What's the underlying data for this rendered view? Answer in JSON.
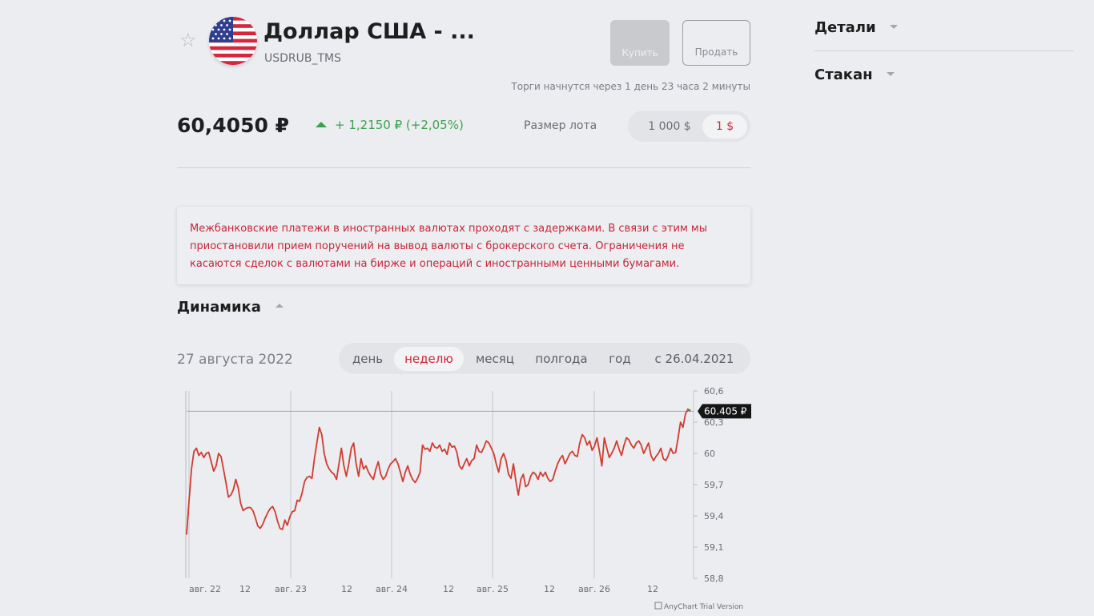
{
  "header": {
    "title": "Доллар США - ...",
    "ticker": "USDRUB_TMS",
    "buy_label": "Купить",
    "sell_label": "Продать",
    "trading_note": "Торги начнутся через 1 день 23 часа 2 минуты"
  },
  "price": {
    "value": "60,4050 ₽",
    "change": "+ 1,2150 ₽ (+2,05%)"
  },
  "lot": {
    "label": "Размер лота",
    "options": [
      "1 000 $",
      "1 $"
    ],
    "selected": "1 $"
  },
  "notice": {
    "text": "Межбанковские платежи в иностранных валютах проходят с задержками. В связи с этим мы приостановили прием поручений на вывод валюты с брокерского счета. Ограничения не касаются сделок с валютами на бирже и операций с иностранными ценными бумагами."
  },
  "dynamics": {
    "title": "Динамика",
    "date": "27 августа 2022",
    "periods": [
      "день",
      "неделю",
      "месяц",
      "полгода",
      "год",
      "с 26.04.2021"
    ],
    "active_period": "неделю"
  },
  "sidebar": {
    "details": "Детали",
    "orderbook": "Стакан"
  },
  "chart_data": {
    "type": "line",
    "x_ticks": [
      "авг. 22",
      "12",
      "авг. 23",
      "12",
      "авг. 24",
      "12",
      "авг. 25",
      "12",
      "авг. 26",
      "12"
    ],
    "y_ticks": [
      "60,6",
      "60,3",
      "60",
      "59,7",
      "59,4",
      "59,1",
      "58,8"
    ],
    "ylim": [
      58.8,
      60.6
    ],
    "current_value_label": "60.405 ₽",
    "current_value": 60.405,
    "watermark": "AnyChart Trial Version",
    "line_color": "#d23a2e",
    "series": [
      {
        "values": [
          59.22,
          59.55,
          59.85,
          60.02,
          60.05,
          59.98,
          60.01,
          59.96,
          60.0,
          60.01,
          59.92,
          59.83,
          59.88,
          60.0,
          59.97,
          59.85,
          59.72,
          59.58,
          59.6,
          59.65,
          59.75,
          59.67,
          59.52,
          59.45,
          59.47,
          59.48,
          59.48,
          59.45,
          59.38,
          59.3,
          59.28,
          59.32,
          59.38,
          59.43,
          59.47,
          59.49,
          59.44,
          59.35,
          59.28,
          59.27,
          59.36,
          59.31,
          59.39,
          59.44,
          59.45,
          59.55,
          59.54,
          59.62,
          59.73,
          59.77,
          59.78,
          59.76,
          59.95,
          60.1,
          60.25,
          60.18,
          60.0,
          59.9,
          59.85,
          59.82,
          59.8,
          59.75,
          59.9,
          60.05,
          59.88,
          59.78,
          59.9,
          60.05,
          60.1,
          59.9,
          59.78,
          59.95,
          59.85,
          59.88,
          59.82,
          59.78,
          59.75,
          59.85,
          59.92,
          59.8,
          59.75,
          59.78,
          59.85,
          59.9,
          59.92,
          59.95,
          59.9,
          59.82,
          59.73,
          59.82,
          59.88,
          59.8,
          59.75,
          59.72,
          59.76,
          59.82,
          60.08,
          60.04,
          60.05,
          60.02,
          60.1,
          60.06,
          60.05,
          60.08,
          60.02,
          60.04,
          59.99,
          60.1,
          60.06,
          60.07,
          60.01,
          59.88,
          59.85,
          59.9,
          59.95,
          59.88,
          59.93,
          59.95,
          60.08,
          60.02,
          60.01,
          60.06,
          60.12,
          60.1,
          60.05,
          60.0,
          59.9,
          59.82,
          59.95,
          60.0,
          59.93,
          59.8,
          59.76,
          59.9,
          59.73,
          59.6,
          59.75,
          59.8,
          59.68,
          59.7,
          59.78,
          59.82,
          59.8,
          59.75,
          59.82,
          59.78,
          59.82,
          59.76,
          59.73,
          59.75,
          59.83,
          59.9,
          59.95,
          59.98,
          59.9,
          59.95,
          60.0,
          60.02,
          59.98,
          59.97,
          60.1,
          60.18,
          60.15,
          60.08,
          60.12,
          60.03,
          60.07,
          60.15,
          60.02,
          59.88,
          60.15,
          60.05,
          59.96,
          60.0,
          60.05,
          60.12,
          60.04,
          59.98,
          60.08,
          60.15,
          60.13,
          60.08,
          60.05,
          60.1,
          60.12,
          60.08,
          60.0,
          60.05,
          60.1,
          59.98,
          59.93,
          59.97,
          60.0,
          60.05,
          59.95,
          59.93,
          59.98,
          60.05,
          60.0,
          60.01,
          60.15,
          60.3,
          60.25,
          60.38,
          60.42,
          60.405
        ]
      }
    ]
  },
  "colors": {
    "accent": "#d0263a",
    "positive": "#3aa14c",
    "background": "#ebedf0"
  },
  "icons": [
    "star-icon",
    "us-flag-icon",
    "triangle-up-icon",
    "chevron-up-icon",
    "chevron-down-icon",
    "chart-logo-icon"
  ]
}
